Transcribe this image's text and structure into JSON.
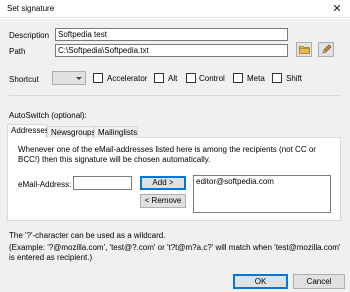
{
  "window": {
    "title": "Set signature",
    "close_glyph": "✕"
  },
  "fields": {
    "description_label": "Description",
    "description_value": "Softpedia test",
    "path_label": "Path",
    "path_value": "C:\\Softpedia\\Softpedia.txt"
  },
  "icons": {
    "browse": "folder-icon",
    "edit": "pencil-icon"
  },
  "shortcut": {
    "label": "Shortcut",
    "selected": "",
    "modifiers": [
      "Accelerator",
      "Alt",
      "Control",
      "Meta",
      "Shift"
    ]
  },
  "autoswitch": {
    "label": "AutoSwitch (optional):",
    "tabs": [
      "Addresses",
      "Newsgroups",
      "Mailinglists"
    ],
    "description": "Whenever one of the eMail-addresses listed here is among the recipients (not CC or BCC!) then this signature will be chosen automatically.",
    "email_label": "eMail-Address:",
    "email_value": "",
    "add_label": "Add >",
    "remove_label": "< Remove",
    "addresses": [
      "editor@softpedia.com"
    ]
  },
  "notes": {
    "wildcard": "The '?'-character can be used as a wildcard.",
    "example": "(Example: '?@mozilla.com', 'test@?.com' or 't?t@m?a.c?' will match when 'test@mozilla.com' is entered as recipient.)"
  },
  "buttons": {
    "ok": "OK",
    "cancel": "Cancel"
  },
  "colors": {
    "accent": "#0078d7",
    "dialog_bg": "#f0f0f0"
  }
}
